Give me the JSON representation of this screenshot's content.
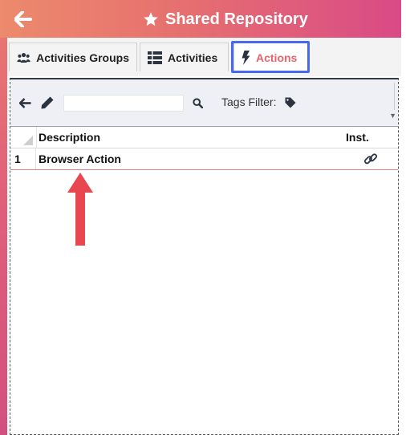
{
  "header": {
    "title": "Shared Repository",
    "back_icon": "arrow-left-icon",
    "title_icon": "star-icon",
    "colors": {
      "gradient_start": "#ec8a6c",
      "gradient_end": "#d94a86"
    }
  },
  "tabs": [
    {
      "label": "Activities Groups",
      "icon": "users-icon",
      "active": false
    },
    {
      "label": "Activities",
      "icon": "list-icon",
      "active": false
    },
    {
      "label": "Actions",
      "icon": "lightning-bolt-icon",
      "active": true
    }
  ],
  "toolbar": {
    "back_icon": "arrow-left-icon",
    "edit_icon": "pencil-icon",
    "search_icon": "search-icon",
    "search_value": "",
    "tags_filter_label": "Tags Filter:",
    "tag_icon": "tag-icon"
  },
  "grid": {
    "columns": [
      "Description",
      "Inst."
    ],
    "rows": [
      {
        "num": "1",
        "description": "Browser Action",
        "inst_icon": "link-icon"
      }
    ]
  },
  "annotation": {
    "icon": "red-arrow-up-icon",
    "color": "#e8474f"
  },
  "colors": {
    "active_tab": "#e8646a",
    "highlight_border": "#4968f0",
    "row_border": "#e57a7a"
  }
}
